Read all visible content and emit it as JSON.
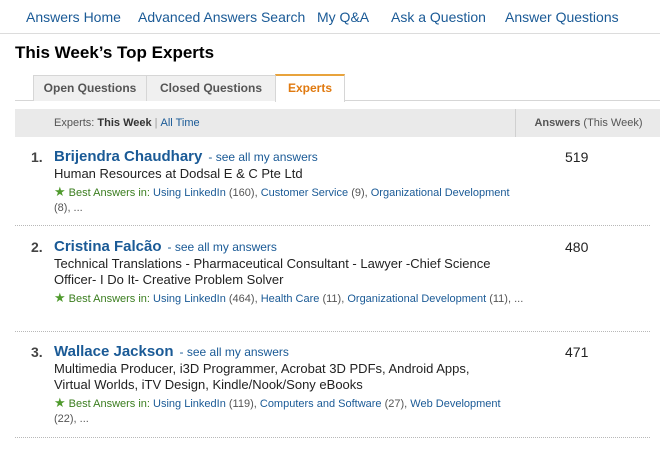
{
  "nav": {
    "items": [
      "Answers Home",
      "Advanced Answers Search",
      "My Q&A",
      "Ask a Question",
      "Answer Questions"
    ]
  },
  "page": {
    "title": "This Week’s Top Experts"
  },
  "tabs": [
    {
      "label": "Open Questions",
      "active": false
    },
    {
      "label": "Closed Questions",
      "active": false
    },
    {
      "label": "Experts",
      "active": true
    }
  ],
  "header": {
    "experts_label": "Experts:",
    "this_week": "This Week",
    "separator": "|",
    "all_time": "All Time",
    "answers_label": "Answers",
    "answers_period": "(This Week)"
  },
  "experts": [
    {
      "rank": "1.",
      "name": "Brijendra Chaudhary",
      "see_all": "- see all my answers",
      "headline": "Human Resources at Dodsal E & C Pte Ltd",
      "count": "519",
      "best_label": "Best Answers in:",
      "categories": [
        {
          "name": "Using LinkedIn",
          "count": "(160),"
        },
        {
          "name": "Customer Service",
          "count": "(9),"
        },
        {
          "name": "Organizational Development",
          "count": "(8), ..."
        }
      ]
    },
    {
      "rank": "2.",
      "name": "Cristina Falcão",
      "see_all": "- see all my answers",
      "headline": "Technical Translations - Pharmaceutical Consultant - Lawyer -Chief Science Officer- I Do It- Creative Problem Solver",
      "count": "480",
      "best_label": "Best Answers in:",
      "categories": [
        {
          "name": "Using LinkedIn",
          "count": "(464),"
        },
        {
          "name": "Health Care",
          "count": "(11),"
        },
        {
          "name": "Organizational Development",
          "count": "(11), ..."
        }
      ]
    },
    {
      "rank": "3.",
      "name": "Wallace Jackson",
      "see_all": "- see all my answers",
      "headline": "Multimedia Producer, i3D Programmer, Acrobat 3D PDFs, Android Apps, Virtual Worlds, iTV Design, Kindle/Nook/Sony eBooks",
      "count": "471",
      "best_label": "Best Answers in:",
      "categories": [
        {
          "name": "Using LinkedIn",
          "count": "(119),"
        },
        {
          "name": "Computers and Software",
          "count": "(27),"
        },
        {
          "name": "Web Development",
          "count": "(22), ..."
        }
      ]
    }
  ],
  "icons": {
    "best_answer": "star-icon"
  },
  "colors": {
    "link": "#1a5a96",
    "active_tab": "#e07a10",
    "star": "#4f9a2d"
  }
}
